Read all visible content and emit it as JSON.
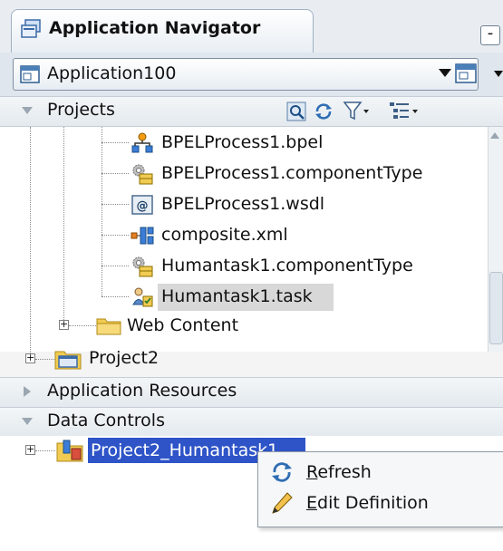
{
  "navigator": {
    "tab_title": "Application Navigator",
    "minimize_glyph": "-",
    "icons": {
      "tab": "application-navigator-icon",
      "app": "application-icon",
      "app_menu": "application-menu-icon"
    }
  },
  "app_selector": {
    "value": "Application100"
  },
  "projects_panel": {
    "header": "Projects",
    "toolbar_icons": [
      "find-icon",
      "refresh-icon",
      "filter-icon",
      "tree-options-icon"
    ],
    "items": [
      {
        "label": "BPELProcess1.bpel",
        "icon": "bpel-process-icon"
      },
      {
        "label": "BPELProcess1.componentType",
        "icon": "component-type-icon"
      },
      {
        "label": "BPELProcess1.wsdl",
        "icon": "wsdl-icon"
      },
      {
        "label": "composite.xml",
        "icon": "composite-icon"
      },
      {
        "label": "Humantask1.componentType",
        "icon": "component-type-icon"
      },
      {
        "label": "Humantask1.task",
        "icon": "human-task-icon",
        "selected": true
      },
      {
        "label": "Web Content",
        "icon": "folder-icon",
        "expandable": true
      },
      {
        "label": "Project2",
        "icon": "project-icon",
        "expandable": true
      }
    ]
  },
  "application_resources": {
    "header": "Application Resources"
  },
  "data_controls": {
    "header": "Data Controls",
    "item_label": "Project2_Humantask1"
  },
  "context_menu": {
    "items": [
      {
        "label_first": "R",
        "label_rest": "efresh",
        "icon": "refresh-icon"
      },
      {
        "label_first": "E",
        "label_rest": "dit Definition",
        "icon": "edit-pencil-icon"
      }
    ]
  },
  "colors": {
    "selection_blue": "#2e54c8",
    "selection_gray": "#d8d8d8",
    "folder_yellow": "#f2cc52",
    "panel_bg": "#f4f4f4"
  }
}
